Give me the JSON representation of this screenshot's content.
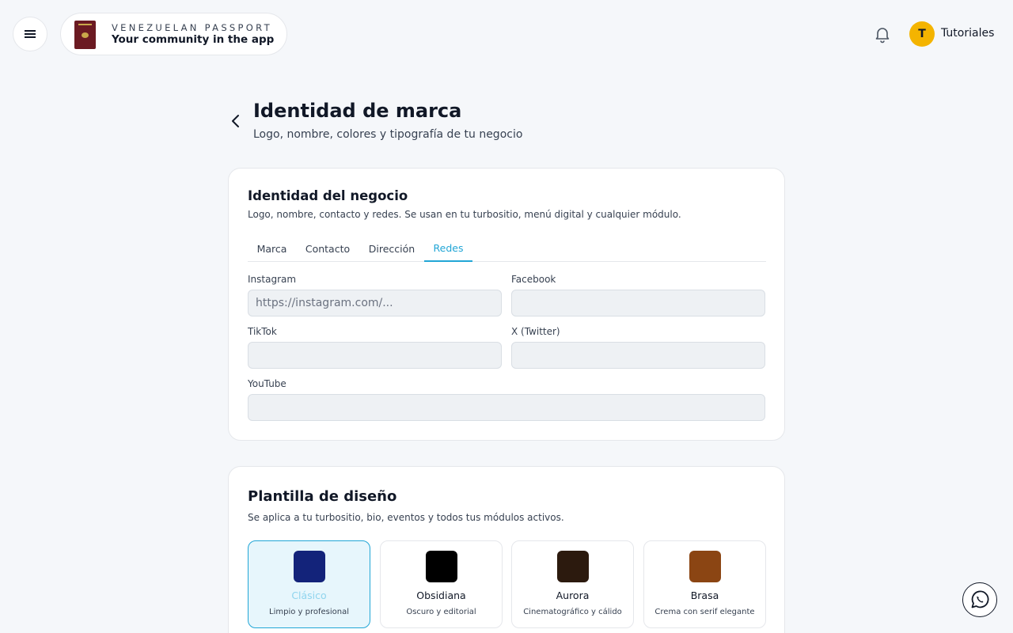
{
  "header": {
    "brand_top": "VENEZUELAN PASSPORT",
    "brand_bottom": "Your community in the app",
    "avatar_initial": "T",
    "user_label": "Tutoriales",
    "icons": [
      "menu-icon",
      "passport-logo",
      "bell-icon",
      "whatsapp-icon"
    ]
  },
  "page": {
    "title": "Identidad de marca",
    "subtitle": "Logo, nombre, colores y tipografía de tu negocio"
  },
  "identity_card": {
    "title": "Identidad del negocio",
    "description": "Logo, nombre, contacto y redes. Se usan en tu turbositio, menú digital y cualquier módulo.",
    "tabs": [
      {
        "label": "Marca"
      },
      {
        "label": "Contacto"
      },
      {
        "label": "Dirección"
      },
      {
        "label": "Redes"
      }
    ],
    "active_tab": "Redes",
    "fields": [
      {
        "label": "Instagram",
        "placeholder": "https://instagram.com/...",
        "value": ""
      },
      {
        "label": "Facebook",
        "placeholder": "",
        "value": ""
      },
      {
        "label": "TikTok",
        "placeholder": "",
        "value": ""
      },
      {
        "label": "X (Twitter)",
        "placeholder": "",
        "value": ""
      },
      {
        "label": "YouTube",
        "placeholder": "",
        "value": ""
      }
    ]
  },
  "template_card": {
    "title": "Plantilla de diseño",
    "description": "Se aplica a tu turbositio, bio, eventos y todos tus módulos activos.",
    "templates": [
      {
        "name": "Clásico",
        "description": "Limpio y profesional",
        "color": "#13237a",
        "selected": true
      },
      {
        "name": "Obsidiana",
        "description": "Oscuro y editorial",
        "color": "#000000",
        "selected": false
      },
      {
        "name": "Aurora",
        "description": "Cinematográfico y cálido",
        "color": "#2c1a0e",
        "selected": false
      },
      {
        "name": "Brasa",
        "description": "Crema con serif elegante",
        "color": "#8b4513",
        "selected": false
      }
    ]
  },
  "colors": {
    "accent": "#22a6d6",
    "avatar_bg": "#f4b400",
    "page_bg": "#f5f7fa"
  }
}
